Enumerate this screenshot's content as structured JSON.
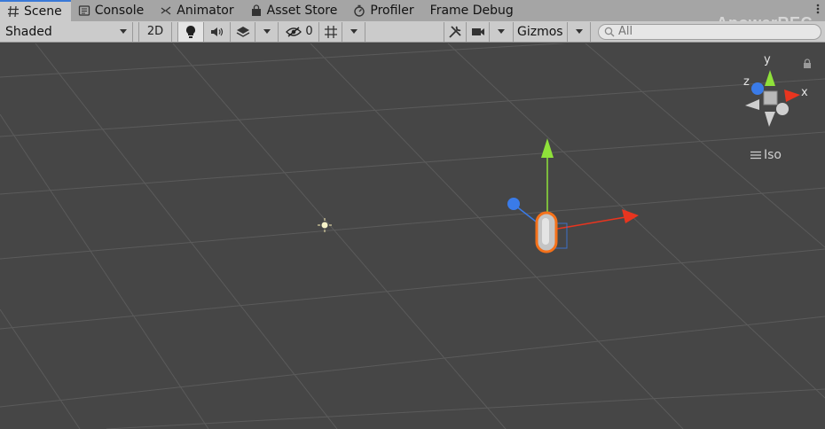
{
  "tabs": [
    {
      "label": "Scene",
      "icon": "hash-icon",
      "active": true
    },
    {
      "label": "Console",
      "icon": "console-icon",
      "active": false
    },
    {
      "label": "Animator",
      "icon": "animator-icon",
      "active": false
    },
    {
      "label": "Asset Store",
      "icon": "bag-icon",
      "active": false
    },
    {
      "label": "Profiler",
      "icon": "profiler-icon",
      "active": false
    },
    {
      "label": "Frame Debug",
      "icon": "",
      "active": false
    }
  ],
  "watermark": "ApowerREC",
  "toolbar": {
    "shading_mode": "Shaded",
    "mode_2d_label": "2D",
    "hidden_count": "0",
    "gizmos_label": "Gizmos",
    "search_placeholder": "All"
  },
  "orientation_gizmo": {
    "x_label": "x",
    "y_label": "y",
    "z_label": "z",
    "projection_label": "Iso"
  },
  "colors": {
    "tabbar": "#a5a5a5",
    "toolbar": "#cbcbcb",
    "scene_bg": "#464646",
    "grid": "#5a5a5a",
    "axis_x": "#e8351f",
    "axis_y": "#8fe13a",
    "axis_z": "#3a7be8",
    "selection": "#f4711a"
  }
}
